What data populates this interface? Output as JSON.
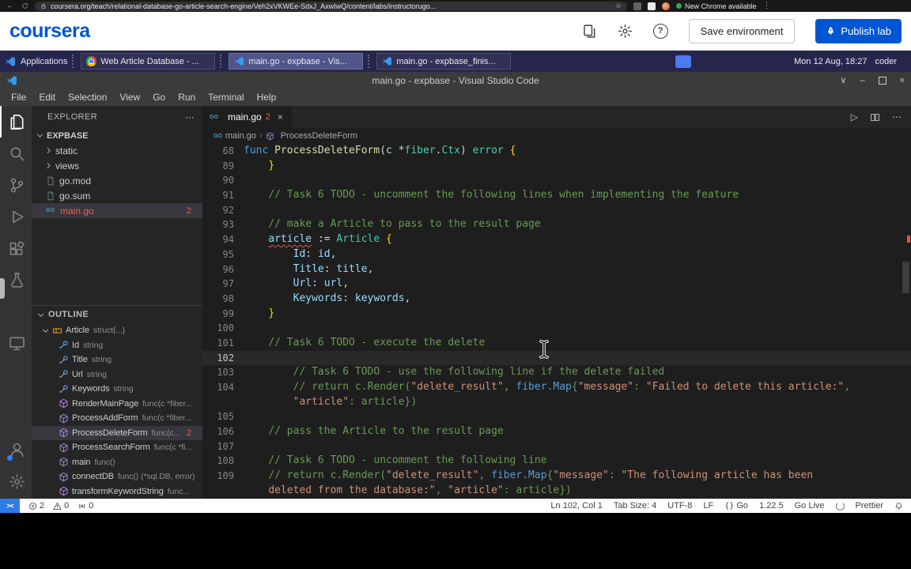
{
  "browser": {
    "url": "coursera.org/teach/relational-database-go-article-search-engine/Veh2xVKWEe-SdxJ_AxwIwQ/content/labs/instructorugo...",
    "update_label": "New Chrome available"
  },
  "coursera": {
    "logo": "coursera",
    "save_button": "Save environment",
    "publish_button": "Publish lab"
  },
  "taskbar": {
    "applications": "Applications",
    "windows": [
      {
        "label": "Web Article Database - ...",
        "icon": "chrome",
        "active": false
      },
      {
        "label": "main.go - expbase - Vis...",
        "icon": "vscode",
        "active": true
      },
      {
        "label": "main.go - expbase_finis...",
        "icon": "vscode",
        "active": false
      }
    ],
    "clock": "Mon 12 Aug, 18:27",
    "user": "coder"
  },
  "vscode": {
    "window_title": "main.go - expbase - Visual Studio Code",
    "menus": [
      "File",
      "Edit",
      "Selection",
      "View",
      "Go",
      "Run",
      "Terminal",
      "Help"
    ],
    "activity_top": [
      {
        "name": "explorer",
        "icon": "files",
        "active": true
      },
      {
        "name": "search",
        "icon": "search"
      },
      {
        "name": "source-control",
        "icon": "scm"
      },
      {
        "name": "run-debug",
        "icon": "debug"
      },
      {
        "name": "extensions",
        "icon": "extensions"
      },
      {
        "name": "testing",
        "icon": "beaker"
      },
      {
        "name": "live-preview",
        "icon": "monitor",
        "gap": true
      }
    ],
    "activity_bottom": [
      {
        "name": "account",
        "icon": "account",
        "dot": true
      },
      {
        "name": "settings",
        "icon": "gear"
      }
    ],
    "explorer": {
      "title": "EXPLORER",
      "root": "EXPBASE",
      "items": [
        {
          "label": "static",
          "type": "folder"
        },
        {
          "label": "views",
          "type": "folder"
        },
        {
          "label": "go.mod",
          "type": "file",
          "icon": "doc"
        },
        {
          "label": "go.sum",
          "type": "file",
          "icon": "doc"
        },
        {
          "label": "main.go",
          "type": "file",
          "icon": "go",
          "badge": "2",
          "selected": true,
          "error": true
        }
      ]
    },
    "outline": {
      "title": "OUTLINE",
      "items": [
        {
          "name": "Article",
          "detail": "struct{...}",
          "kind": "struct",
          "root": true
        },
        {
          "name": "Id",
          "detail": "string",
          "kind": "field"
        },
        {
          "name": "Title",
          "detail": "string",
          "kind": "field"
        },
        {
          "name": "Url",
          "detail": "string",
          "kind": "field"
        },
        {
          "name": "Keywords",
          "detail": "string",
          "kind": "field"
        },
        {
          "name": "RenderMainPage",
          "detail": "func(c *fiber...",
          "kind": "method"
        },
        {
          "name": "ProcessAddForm",
          "detail": "func(c *fiber...",
          "kind": "method"
        },
        {
          "name": "ProcessDeleteForm",
          "detail": "func(c...",
          "kind": "method",
          "badge": "2",
          "selected": true
        },
        {
          "name": "ProcessSearchForm",
          "detail": "func(c *fi...",
          "kind": "method"
        },
        {
          "name": "main",
          "detail": "func()",
          "kind": "method"
        },
        {
          "name": "connectDB",
          "detail": "func() (*sql.DB, error)",
          "kind": "method"
        },
        {
          "name": "transformKeywordString",
          "detail": "func...",
          "kind": "method"
        }
      ]
    },
    "tab": {
      "label": "main.go",
      "badge": "2"
    },
    "breadcrumbs": [
      {
        "label": "main.go",
        "icon": "go"
      },
      {
        "label": "ProcessDeleteForm",
        "icon": "method"
      }
    ],
    "code": {
      "lines": [
        {
          "n": "68",
          "tok": [
            [
              "func",
              "kw"
            ],
            [
              " ",
              ""
            ],
            [
              "ProcessDeleteForm",
              "fn"
            ],
            [
              "(",
              "pu"
            ],
            [
              "c",
              "vr"
            ],
            [
              " *",
              "pu"
            ],
            [
              "fiber",
              "ty"
            ],
            [
              ".",
              "pu"
            ],
            [
              "Ctx",
              "ty"
            ],
            [
              ") ",
              "pu"
            ],
            [
              "error",
              "ty"
            ],
            [
              " ",
              ""
            ],
            [
              "{",
              "br"
            ]
          ]
        },
        {
          "n": "89",
          "tok": [
            [
              "    ",
              ""
            ],
            [
              "}",
              "br"
            ]
          ]
        },
        {
          "n": "90",
          "tok": []
        },
        {
          "n": "91",
          "tok": [
            [
              "    ",
              ""
            ],
            [
              "// Task 6 TODO - uncomment the following lines when implementing the feature",
              "cm"
            ]
          ]
        },
        {
          "n": "92",
          "tok": []
        },
        {
          "n": "93",
          "tok": [
            [
              "    ",
              ""
            ],
            [
              "// make a Article to pass to the result page",
              "cm"
            ]
          ]
        },
        {
          "n": "94",
          "tok": [
            [
              "    ",
              ""
            ],
            [
              "article",
              "vrerr"
            ],
            [
              " ",
              ""
            ],
            [
              ":=",
              "pu"
            ],
            [
              " ",
              ""
            ],
            [
              "Article",
              "ty"
            ],
            [
              " ",
              ""
            ],
            [
              "{",
              "br"
            ]
          ]
        },
        {
          "n": "95",
          "tok": [
            [
              "        ",
              ""
            ],
            [
              "Id",
              "vr"
            ],
            [
              ":",
              "pu"
            ],
            [
              " ",
              ""
            ],
            [
              "id",
              "vr"
            ],
            [
              ",",
              "pu"
            ]
          ]
        },
        {
          "n": "96",
          "tok": [
            [
              "        ",
              ""
            ],
            [
              "Title",
              "vr"
            ],
            [
              ":",
              "pu"
            ],
            [
              " ",
              ""
            ],
            [
              "title",
              "vr"
            ],
            [
              ",",
              "pu"
            ]
          ]
        },
        {
          "n": "97",
          "tok": [
            [
              "        ",
              ""
            ],
            [
              "Url",
              "vr"
            ],
            [
              ":",
              "pu"
            ],
            [
              " ",
              ""
            ],
            [
              "url",
              "vr"
            ],
            [
              ",",
              "pu"
            ]
          ]
        },
        {
          "n": "98",
          "tok": [
            [
              "        ",
              ""
            ],
            [
              "Keywords",
              "vr"
            ],
            [
              ":",
              "pu"
            ],
            [
              " ",
              ""
            ],
            [
              "keywords",
              "vr"
            ],
            [
              ",",
              "pu"
            ]
          ]
        },
        {
          "n": "99",
          "tok": [
            [
              "    ",
              ""
            ],
            [
              "}",
              "br"
            ]
          ]
        },
        {
          "n": "100",
          "tok": []
        },
        {
          "n": "101",
          "tok": [
            [
              "    ",
              ""
            ],
            [
              "// Task 6 TODO - execute the delete",
              "cm"
            ]
          ]
        },
        {
          "n": "102",
          "cur": true,
          "tok": []
        },
        {
          "n": "103",
          "tok": [
            [
              "        ",
              ""
            ],
            [
              "// Task 6 TODO - use the following line if the delete failed",
              "cm"
            ]
          ]
        },
        {
          "n": "104",
          "tok": [
            [
              "        ",
              ""
            ],
            [
              "// return c.Render(",
              "cm"
            ],
            [
              "\"delete_result\"",
              "st"
            ],
            [
              ", ",
              "cm"
            ],
            [
              "fiber.Map",
              "tyb"
            ],
            [
              "{",
              "cm"
            ],
            [
              "\"message\"",
              "st"
            ],
            [
              ": ",
              "cm"
            ],
            [
              "\"Failed to delete this article:\"",
              "st"
            ],
            [
              ",",
              "cm"
            ]
          ]
        },
        {
          "n": "",
          "tok": [
            [
              "        ",
              ""
            ],
            [
              "\"article\"",
              "st"
            ],
            [
              ": article})",
              "cm"
            ]
          ]
        },
        {
          "n": "105",
          "tok": []
        },
        {
          "n": "106",
          "tok": [
            [
              "    ",
              ""
            ],
            [
              "// pass the Article to the result page",
              "cm"
            ]
          ]
        },
        {
          "n": "107",
          "tok": []
        },
        {
          "n": "108",
          "tok": [
            [
              "    ",
              ""
            ],
            [
              "// Task 6 TODO - uncomment the following line",
              "cm"
            ]
          ]
        },
        {
          "n": "109",
          "tok": [
            [
              "    ",
              ""
            ],
            [
              "// return c.Render(",
              "cm"
            ],
            [
              "\"delete_result\"",
              "st"
            ],
            [
              ", ",
              "cm"
            ],
            [
              "fiber.Map",
              "tyb"
            ],
            [
              "{",
              "cm"
            ],
            [
              "\"message\"",
              "st"
            ],
            [
              ": ",
              "cm"
            ],
            [
              "\"The following article has been",
              "st"
            ]
          ]
        },
        {
          "n": "",
          "tok": [
            [
              "    ",
              ""
            ],
            [
              "deleted from the database:\"",
              "st"
            ],
            [
              ", ",
              "cm"
            ],
            [
              "\"article\"",
              "st"
            ],
            [
              ": article})",
              "cm"
            ]
          ]
        }
      ]
    },
    "status": {
      "errors": "2",
      "warnings": "0",
      "ports": "0",
      "right": [
        {
          "name": "cursor-position",
          "label": "Ln 102, Col 1"
        },
        {
          "name": "indentation",
          "label": "Tab Size: 4"
        },
        {
          "name": "encoding",
          "label": "UTF-8"
        },
        {
          "name": "eol",
          "label": "LF"
        },
        {
          "name": "language-mode",
          "label": "Go",
          "icon": "braces"
        },
        {
          "name": "go-version",
          "label": "1.22.5"
        },
        {
          "name": "go-live",
          "label": "Go Live"
        },
        {
          "name": "sync-spinner",
          "label": "",
          "icon": "spinner"
        },
        {
          "name": "prettier",
          "label": "Prettier"
        },
        {
          "name": "notifications",
          "label": "",
          "icon": "bell"
        }
      ]
    }
  }
}
